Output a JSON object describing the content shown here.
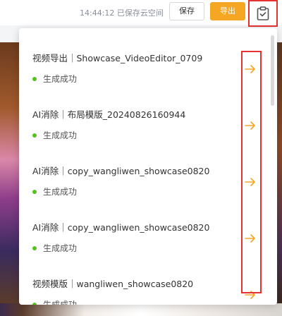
{
  "toolbar": {
    "save_status": "14:44:12 已保存云空间",
    "save_label": "保存",
    "export_label": "导出",
    "task_icon": "clipboard-check-icon"
  },
  "colors": {
    "accent": "#f5a623",
    "highlight": "#e5312f",
    "success": "#52c41a"
  },
  "tasks": [
    {
      "title": "视频导出｜Showcase_VideoEditor_0709",
      "status": "生成成功",
      "icon": "arrow-right-icon"
    },
    {
      "title": "AI消除｜布局模版_20240826160944",
      "status": "生成成功",
      "icon": "arrow-right-icon"
    },
    {
      "title": "AI消除｜copy_wangliwen_showcase0820",
      "status": "生成成功",
      "icon": "arrow-right-icon"
    },
    {
      "title": "AI消除｜copy_wangliwen_showcase0820",
      "status": "生成成功",
      "icon": "arrow-right-icon"
    },
    {
      "title": "视频模版｜wangliwen_showcase0820",
      "status": "生成成功",
      "icon": "arrow-right-icon"
    }
  ]
}
